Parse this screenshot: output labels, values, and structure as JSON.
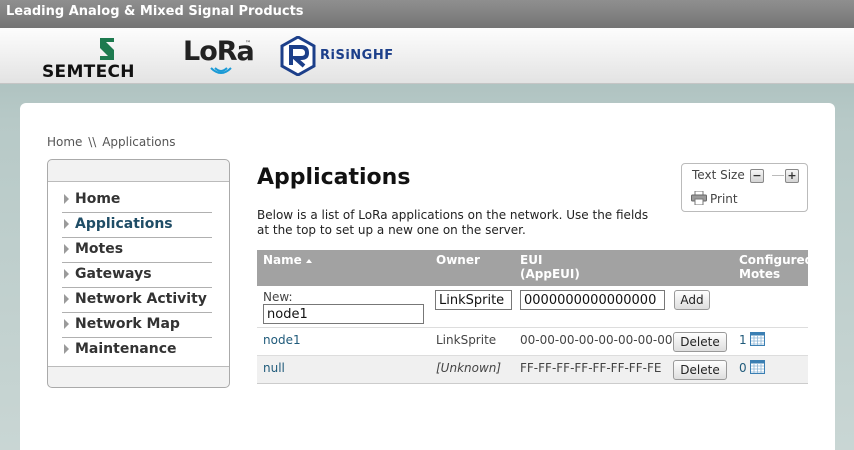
{
  "topbar": {
    "title": "Leading Analog & Mixed Signal Products"
  },
  "header": {
    "logos": [
      {
        "name": "semtech-logo",
        "text": "SEMTECH"
      },
      {
        "name": "lora-logo",
        "text": "LoRa",
        "tm": "™"
      },
      {
        "name": "risinghf-logo",
        "text": "RiSiNGHF"
      }
    ]
  },
  "breadcrumb": {
    "home": "Home",
    "separator": "\\\\",
    "current": "Applications"
  },
  "sidebar": {
    "items": [
      {
        "label": "Home",
        "active": false
      },
      {
        "label": "Applications",
        "active": true
      },
      {
        "label": "Motes",
        "active": false
      },
      {
        "label": "Gateways",
        "active": false
      },
      {
        "label": "Network Activity",
        "active": false
      },
      {
        "label": "Network Map",
        "active": false
      },
      {
        "label": "Maintenance",
        "active": false
      }
    ]
  },
  "page": {
    "title": "Applications",
    "intro": "Below is a list of LoRa applications on the network. Use the fields at the top to set up a new one on the server."
  },
  "text_size": {
    "label": "Text Size",
    "decrease": "−",
    "increase": "+",
    "print_label": "Print"
  },
  "table": {
    "columns": {
      "name": "Name",
      "owner": "Owner",
      "eui_line1": "EUI",
      "eui_line2": "(AppEUI)",
      "motes_line1": "Configured",
      "motes_line2": "Motes"
    },
    "new_row": {
      "label": "New:",
      "name_value": "node1",
      "owner_value": "LinkSprite",
      "eui_value": "0000000000000000",
      "add_label": "Add"
    },
    "rows": [
      {
        "name": "node1",
        "owner": "LinkSprite",
        "eui": "00-00-00-00-00-00-00-00",
        "delete_label": "Delete",
        "motes": "1"
      },
      {
        "name": "null",
        "owner": "[Unknown]",
        "eui": "FF-FF-FF-FF-FF-FF-FF-FE",
        "delete_label": "Delete",
        "motes": "0"
      }
    ]
  },
  "colors": {
    "accent": "#1f5a7a",
    "header_gray": "#a2a2a2",
    "semtech_green": "#1d7a4f",
    "risinghf_blue": "#1c3f8a"
  }
}
